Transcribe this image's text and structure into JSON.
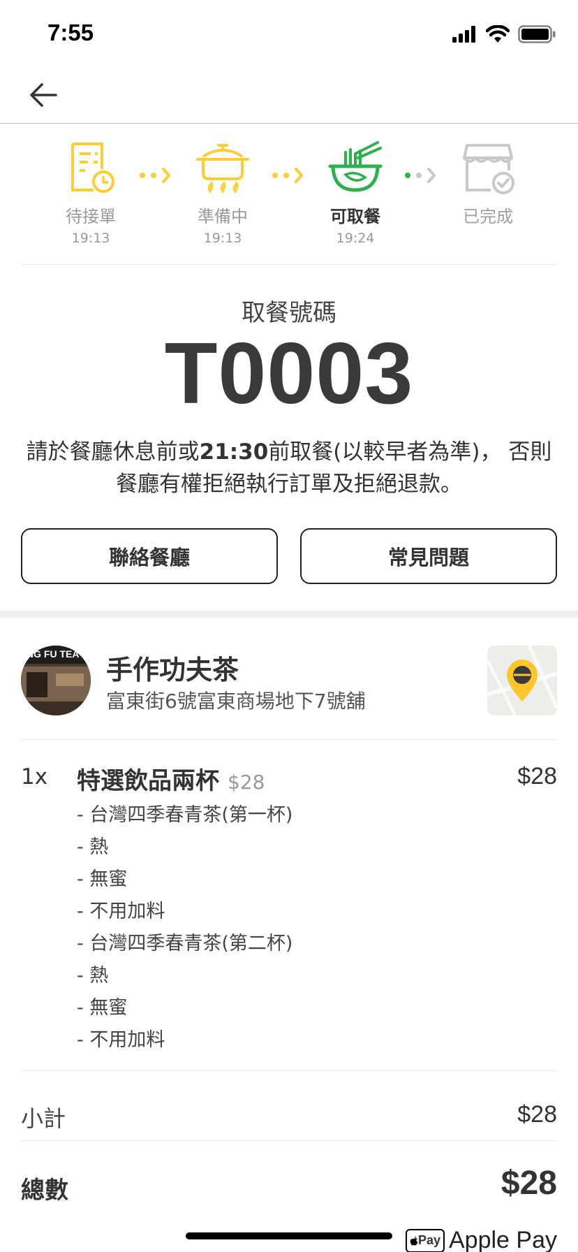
{
  "status_bar": {
    "time": "7:55"
  },
  "steps": [
    {
      "label": "待接單",
      "time": "19:13",
      "state": "done"
    },
    {
      "label": "準備中",
      "time": "19:13",
      "state": "done"
    },
    {
      "label": "可取餐",
      "time": "19:24",
      "state": "active"
    },
    {
      "label": "已完成",
      "time": "",
      "state": "inactive"
    }
  ],
  "pickup": {
    "title": "取餐號碼",
    "number": "T0003",
    "note_pre": "請於餐廳休息前或",
    "note_time": "21:30",
    "note_post": "前取餐(以較早者為準)， 否則餐廳有權拒絕執行訂單及拒絕退款。"
  },
  "buttons": {
    "contact": "聯絡餐廳",
    "faq": "常見問題"
  },
  "store": {
    "name": "手作功夫茶",
    "address": "富東街6號富東商場地下7號舖",
    "avatar_text": "NG FU TEA"
  },
  "item": {
    "qty": "1x",
    "name": "特選飲品兩杯",
    "unit_price": "$28",
    "price": "$28",
    "options": [
      "- 台灣四季春青茶(第一杯)",
      "- 熱",
      "- 無蜜",
      "- 不用加料",
      "- 台灣四季春青茶(第二杯)",
      "- 熱",
      "- 無蜜",
      "- 不用加料"
    ]
  },
  "summary": {
    "subtotal_label": "小計",
    "subtotal_value": "$28",
    "total_label": "總數",
    "total_value": "$28"
  },
  "payment": {
    "badge": "Pay",
    "label": "Apple Pay"
  },
  "colors": {
    "yellow": "#FFCC33",
    "green": "#2BB24C",
    "grey": "#C8C8C8",
    "text": "#333333"
  }
}
